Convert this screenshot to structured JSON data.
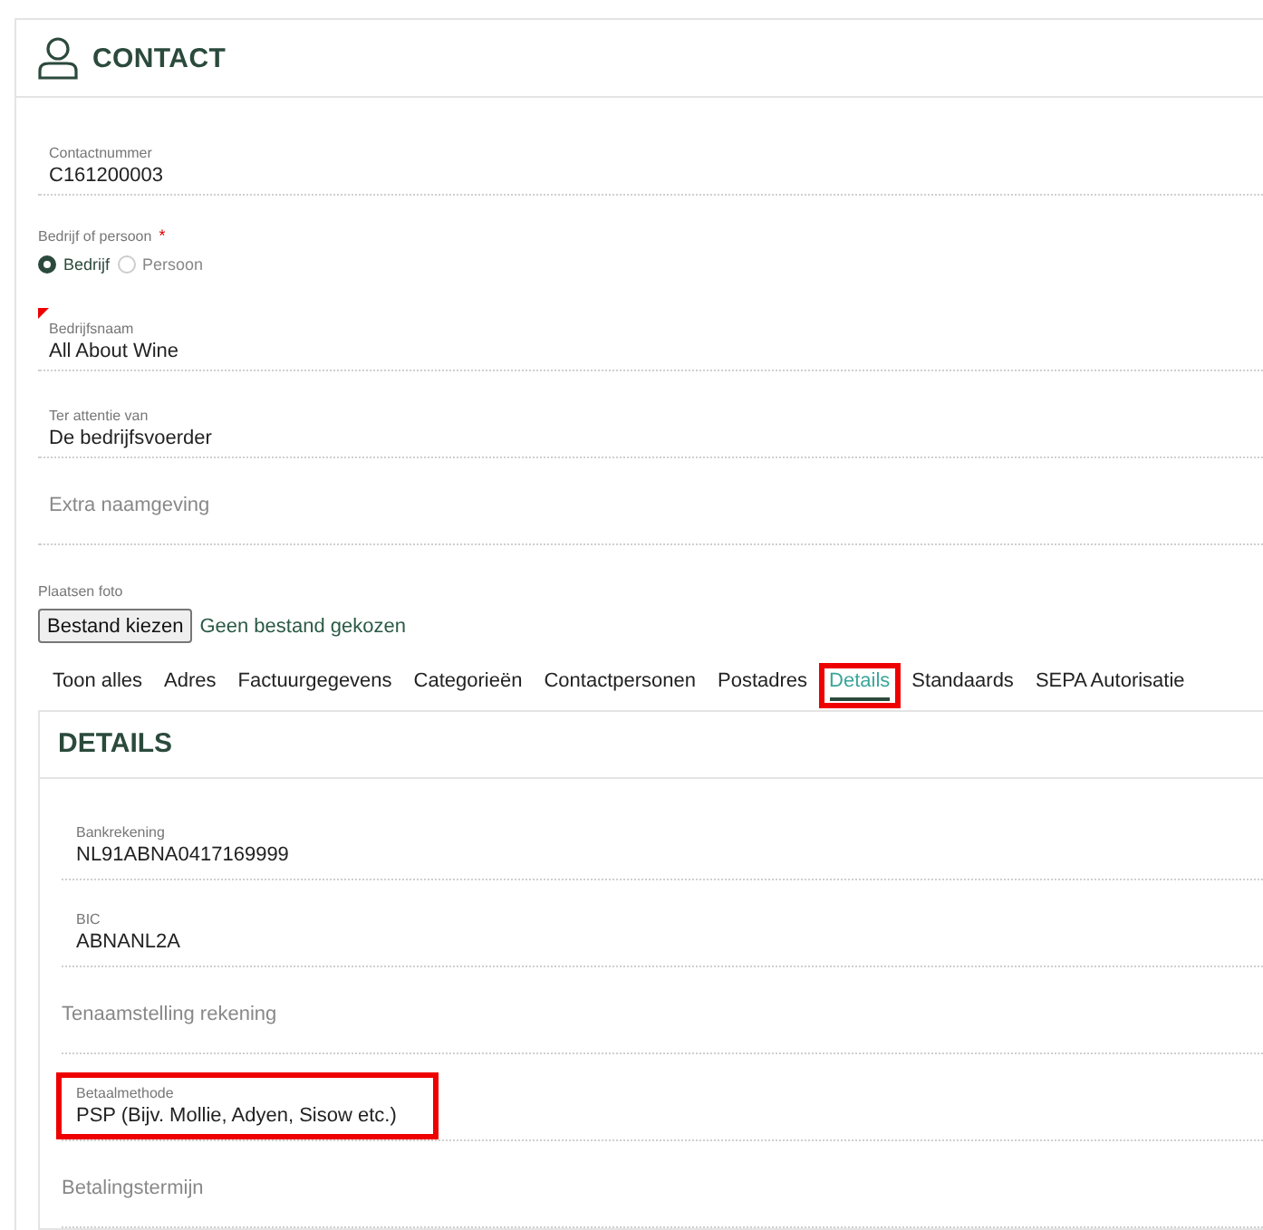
{
  "header": {
    "title": "CONTACT"
  },
  "fields": [
    {
      "kind": "filled",
      "label": "Contactnummer",
      "value": "C161200003",
      "flagged": false
    },
    {
      "kind": "radio",
      "label": "Bedrijf of persoon",
      "required_mark": "*",
      "options": [
        {
          "label": "Bedrijf",
          "selected": true
        },
        {
          "label": "Persoon",
          "selected": false
        }
      ]
    },
    {
      "kind": "filled",
      "label": "Bedrijfsnaam",
      "value": "All About Wine",
      "flagged": true
    },
    {
      "kind": "filled",
      "label": "Ter attentie van",
      "value": "De bedrijfsvoerder",
      "flagged": false
    },
    {
      "kind": "empty",
      "placeholder": "Extra naamgeving"
    },
    {
      "kind": "file",
      "label": "Plaatsen foto",
      "button": "Bestand kiezen",
      "status": "Geen bestand gekozen"
    }
  ],
  "tabs": [
    {
      "label": "Toon alles",
      "selected": false,
      "highlighted": false
    },
    {
      "label": "Adres",
      "selected": false,
      "highlighted": false
    },
    {
      "label": "Factuurgegevens",
      "selected": false,
      "highlighted": false
    },
    {
      "label": "Categorieën",
      "selected": false,
      "highlighted": false
    },
    {
      "label": "Contactpersonen",
      "selected": false,
      "highlighted": false
    },
    {
      "label": "Postadres",
      "selected": false,
      "highlighted": false
    },
    {
      "label": "Details",
      "selected": true,
      "highlighted": true
    },
    {
      "label": "Standaards",
      "selected": false,
      "highlighted": false
    },
    {
      "label": "SEPA Autorisatie",
      "selected": false,
      "highlighted": false
    }
  ],
  "details": {
    "title": "DETAILS",
    "fields": [
      {
        "kind": "filled",
        "label": "Bankrekening",
        "value": "NL91ABNA0417169999",
        "highlighted": false
      },
      {
        "kind": "filled",
        "label": "BIC",
        "value": "ABNANL2A",
        "highlighted": false
      },
      {
        "kind": "empty",
        "placeholder": "Tenaamstelling rekening"
      },
      {
        "kind": "filled",
        "label": "Betaalmethode",
        "value": "PSP (Bijv. Mollie, Adyen, Sisow etc.)",
        "highlighted": true
      },
      {
        "kind": "empty",
        "placeholder": "Betalingstermijn"
      }
    ]
  }
}
